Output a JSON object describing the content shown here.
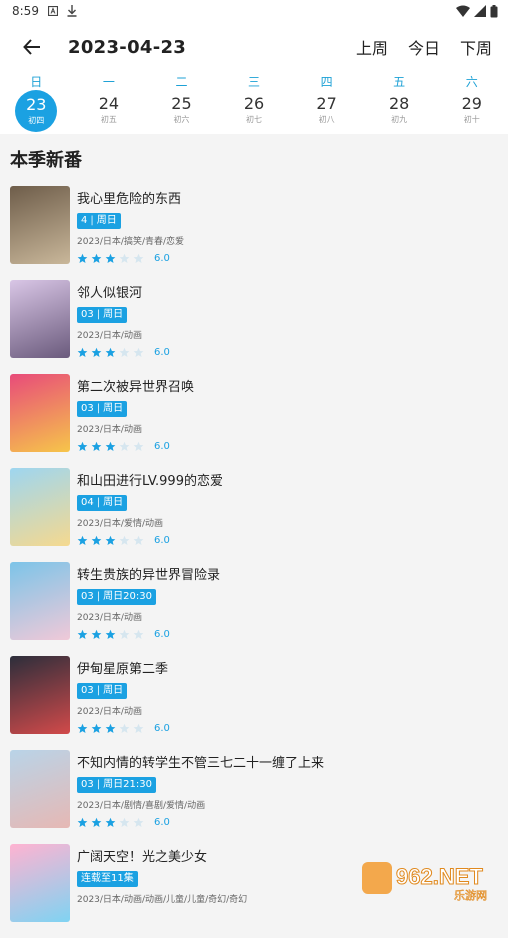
{
  "status_bar": {
    "time": "8:59"
  },
  "header": {
    "date": "2023-04-23",
    "prev_week": "上周",
    "this_week": "今日",
    "next_week": "下周"
  },
  "week": [
    {
      "weekday": "日",
      "day": "23",
      "lunar": "初四",
      "selected": true
    },
    {
      "weekday": "一",
      "day": "24",
      "lunar": "初五"
    },
    {
      "weekday": "二",
      "day": "25",
      "lunar": "初六"
    },
    {
      "weekday": "三",
      "day": "26",
      "lunar": "初七"
    },
    {
      "weekday": "四",
      "day": "27",
      "lunar": "初八"
    },
    {
      "weekday": "五",
      "day": "28",
      "lunar": "初九"
    },
    {
      "weekday": "六",
      "day": "29",
      "lunar": "初十"
    }
  ],
  "section_title": "本季新番",
  "items": [
    {
      "title": "我心里危险的东西",
      "ep": "4",
      "time": "周日",
      "meta": "2023/日本/搞笑/青春/恋爱",
      "rating": "6.0",
      "stars_filled": 3,
      "cover_colors": [
        "#6e5d4a",
        "#c9b79a"
      ]
    },
    {
      "title": "邻人似银河",
      "ep": "03",
      "time": "周日",
      "meta": "2023/日本/动画",
      "rating": "6.0",
      "stars_filled": 3,
      "cover_colors": [
        "#d9c6e6",
        "#6a5a7c"
      ]
    },
    {
      "title": "第二次被异世界召唤",
      "ep": "03",
      "time": "周日",
      "meta": "2023/日本/动画",
      "rating": "6.0",
      "stars_filled": 3,
      "cover_colors": [
        "#e84b7a",
        "#f6c54a"
      ]
    },
    {
      "title": "和山田进行LV.999的恋爱",
      "ep": "04",
      "time": "周日",
      "meta": "2023/日本/爱情/动画",
      "rating": "6.0",
      "stars_filled": 3,
      "cover_colors": [
        "#9ed6f0",
        "#f5d98f"
      ]
    },
    {
      "title": "转生贵族的异世界冒险录",
      "ep": "03",
      "time": "周日20:30",
      "meta": "2023/日本/动画",
      "rating": "6.0",
      "stars_filled": 3,
      "cover_colors": [
        "#7cc4e8",
        "#f0c9d8"
      ]
    },
    {
      "title": "伊甸星原第二季",
      "ep": "03",
      "time": "周日",
      "meta": "2023/日本/动画",
      "rating": "6.0",
      "stars_filled": 3,
      "cover_colors": [
        "#2c2e3b",
        "#d24a4a"
      ]
    },
    {
      "title": "不知内情的转学生不管三七二十一缠了上来",
      "ep": "03",
      "time": "周日21:30",
      "meta": "2023/日本/剧情/喜剧/爱情/动画",
      "rating": "6.0",
      "stars_filled": 3,
      "cover_colors": [
        "#b9d4e8",
        "#e6b8b4"
      ]
    },
    {
      "title": "广阔天空！光之美少女",
      "badge_text": "连载至11集",
      "meta": "2023/日本/动画/动画/儿童/儿童/奇幻/奇幻",
      "rating": "",
      "stars_filled": 0,
      "cover_colors": [
        "#ffb3d1",
        "#7fd3f2"
      ]
    }
  ],
  "watermark": {
    "brand": "962.NET",
    "sub": "乐游网"
  },
  "colors": {
    "accent": "#1ba1e2",
    "star_on": "#1ba1e2",
    "star_off": "#d6e6ef"
  }
}
